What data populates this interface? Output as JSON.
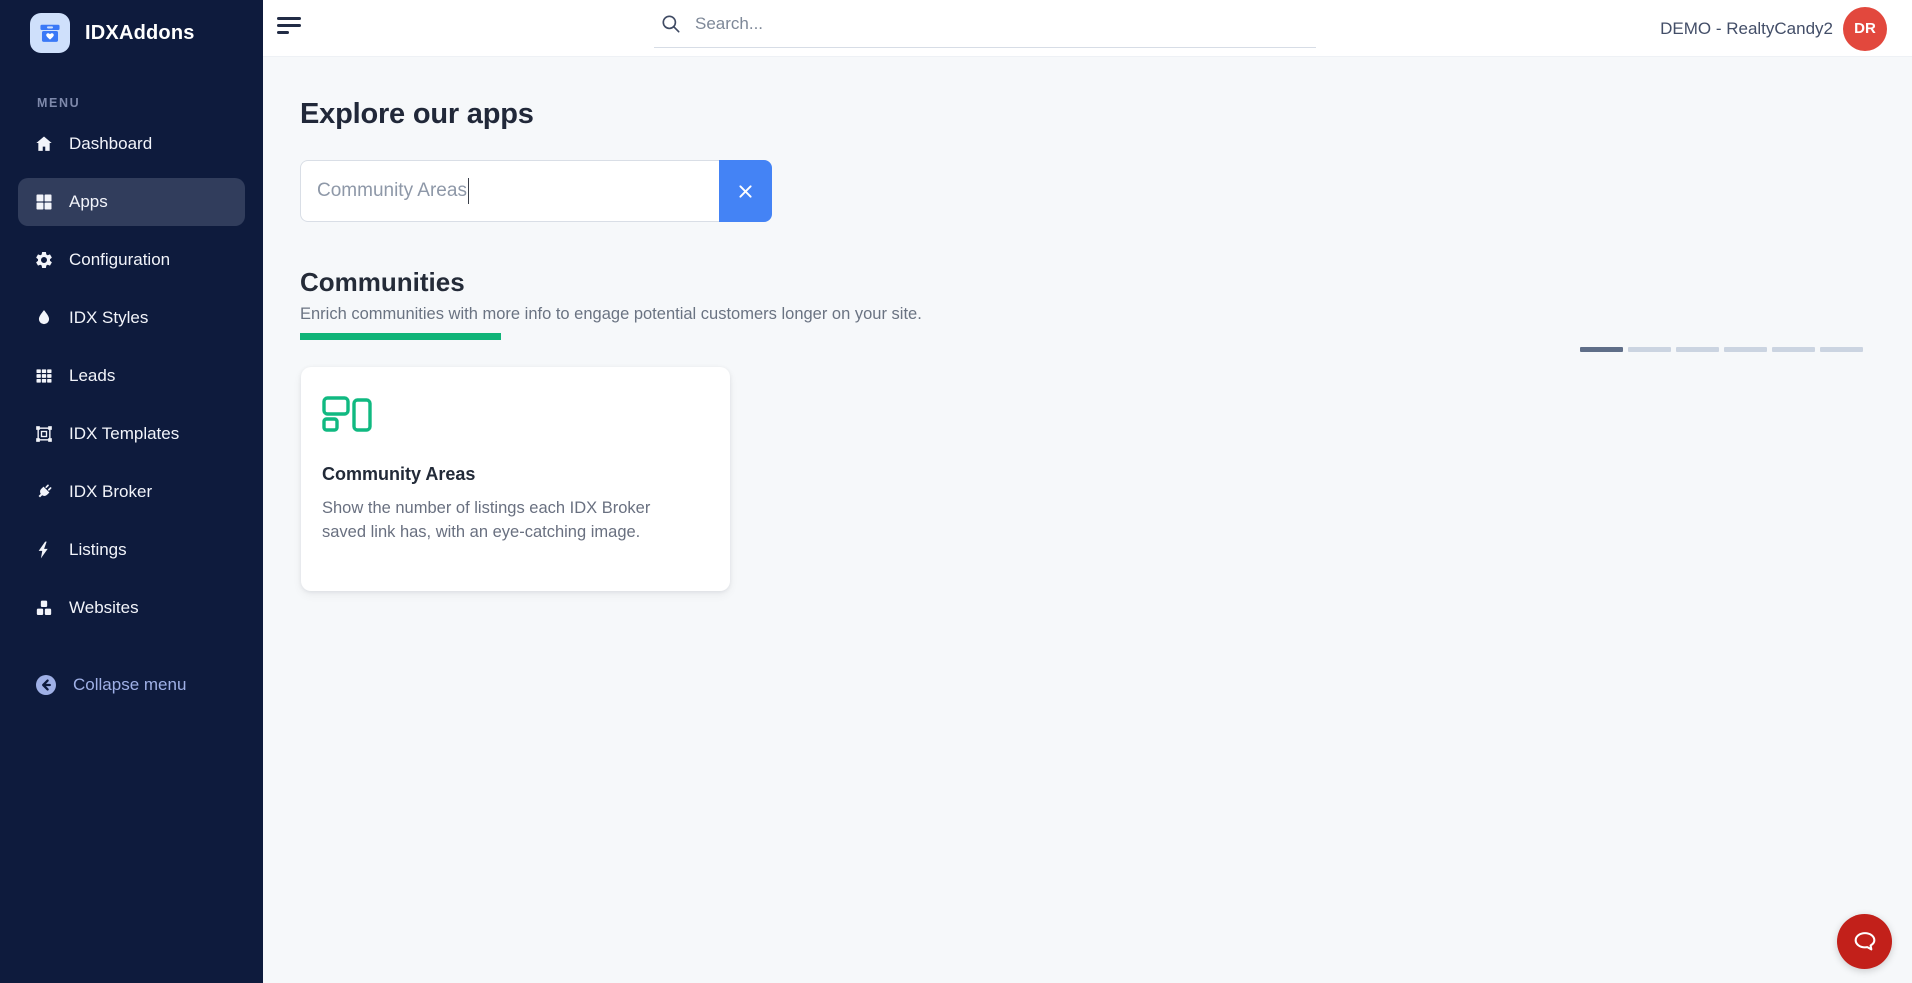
{
  "brand": {
    "name": "IDXAddons"
  },
  "sidebar": {
    "menu_label": "MENU",
    "items": [
      {
        "label": "Dashboard",
        "icon": "home-icon",
        "active": false
      },
      {
        "label": "Apps",
        "icon": "apps-grid-icon",
        "active": true
      },
      {
        "label": "Configuration",
        "icon": "gear-icon",
        "active": false
      },
      {
        "label": "IDX Styles",
        "icon": "droplet-icon",
        "active": false
      },
      {
        "label": "Leads",
        "icon": "table-cells-icon",
        "active": false
      },
      {
        "label": "IDX Templates",
        "icon": "object-frame-icon",
        "active": false
      },
      {
        "label": "IDX Broker",
        "icon": "plug-icon",
        "active": false
      },
      {
        "label": "Listings",
        "icon": "bolt-icon",
        "active": false
      },
      {
        "label": "Websites",
        "icon": "cubes-icon",
        "active": false
      }
    ],
    "collapse": {
      "label": "Collapse menu",
      "icon": "arrow-left-circle-icon"
    }
  },
  "topbar": {
    "search": {
      "placeholder": "Search...",
      "icon": "search-icon"
    },
    "account": {
      "label": "DEMO - RealtyCandy2",
      "avatar_initials": "DR",
      "avatar_color": "#e2483d"
    }
  },
  "main": {
    "title": "Explore our apps",
    "filter": {
      "value": "Community Areas",
      "clear_icon": "x-icon",
      "clear_color": "#4483f5"
    },
    "section": {
      "title": "Communities",
      "description": "Enrich communities with more info to engage potential customers longer on your site.",
      "accent_color": "#10b478",
      "pagination": {
        "total": 6,
        "active_index": 0
      }
    },
    "cards": [
      {
        "title": "Community Areas",
        "description": "Show the number of listings each IDX Broker saved link has, with an eye-catching image.",
        "icon": "layout-blocks-icon",
        "icon_color": "#10b981"
      }
    ]
  },
  "chat": {
    "icon": "chat-bubble-icon",
    "color": "#c2201a"
  }
}
